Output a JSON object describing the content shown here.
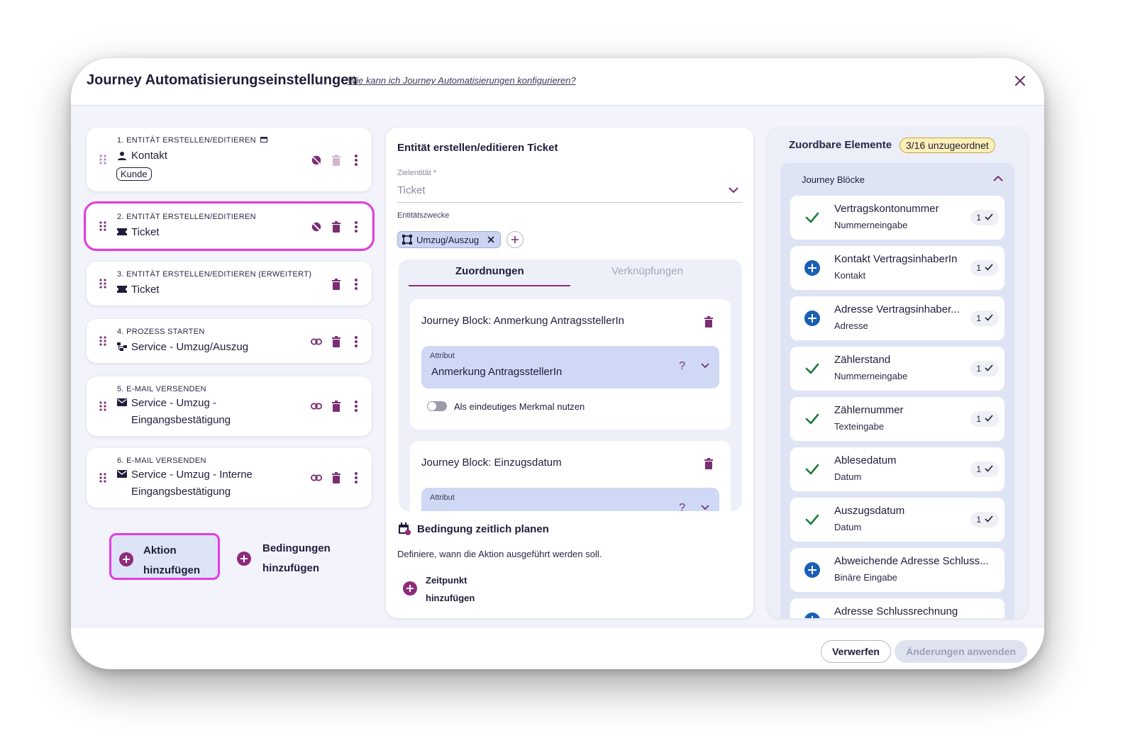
{
  "header": {
    "title": "Journey Automatisierungseinstellungen",
    "help_link": "Wie kann ich Journey Automatisierungen konfigurieren?"
  },
  "actions": [
    {
      "kicker": "1. ENTITÄT ERSTELLEN/EDITIEREN",
      "title": "Kontakt",
      "title_icon": "person-icon",
      "tag": "Kunde"
    },
    {
      "kicker": "2. ENTITÄT ERSTELLEN/EDITIEREN",
      "title": "Ticket",
      "title_icon": "ticket-icon"
    },
    {
      "kicker": "3. ENTITÄT ERSTELLEN/EDITIEREN (ERWEITERT)",
      "title": "Ticket",
      "title_icon": "ticket-icon"
    },
    {
      "kicker": "4. PROZESS STARTEN",
      "title": "Service - Umzug/Auszug",
      "title_icon": "workflow-icon"
    },
    {
      "kicker": "5. E-MAIL VERSENDEN",
      "title_line1": "Service - Umzug -",
      "title_line2": "Eingangsbestätigung",
      "title_icon": "mail-icon"
    },
    {
      "kicker": "6. E-MAIL VERSENDEN",
      "title_line1": "Service - Umzug - Interne",
      "title_line2": "Eingangsbestätigung",
      "title_icon": "mail-icon"
    }
  ],
  "left_buttons": {
    "add_action_line1": "Aktion",
    "add_action_line2": "hinzufügen",
    "add_condition_line1": "Bedingungen",
    "add_condition_line2": "hinzufügen"
  },
  "editor": {
    "title": "Entität erstellen/editieren Ticket",
    "target_label": "Zielentität *",
    "target_value": "Ticket",
    "purposes_label": "Entitätszwecke",
    "purpose_chip": "Umzug/Auszug",
    "tabs": [
      "Zuordnungen",
      "Verknüpfungen"
    ],
    "blocks": [
      {
        "title": "Journey Block: Anmerkung AntragsstellerIn",
        "attr_label": "Attribut",
        "attr_value": "Anmerkung AntragsstellerIn",
        "toggle_label": "Als eindeutiges Merkmal nutzen"
      },
      {
        "title": "Journey Block: Einzugsdatum",
        "attr_label": "Attribut",
        "attr_value": ""
      }
    ],
    "schedule_title": "Bedingung zeitlich planen",
    "schedule_desc": "Definiere, wann die Aktion ausgeführt werden soll.",
    "add_time_line1": "Zeitpunkt",
    "add_time_line2": "hinzufügen"
  },
  "right": {
    "title": "Zuordbare Elemente",
    "badge": "3/16 unzugeordnet",
    "section": "Journey Blöcke",
    "items": [
      {
        "name": "Vertragskontonummer",
        "type": "Nummerneingabe",
        "count": "1",
        "status": "check"
      },
      {
        "name": "Kontakt VertragsinhaberIn",
        "type": "Kontakt",
        "count": "1",
        "status": "add"
      },
      {
        "name": "Adresse Vertragsinhaber...",
        "type": "Adresse",
        "count": "1",
        "status": "add"
      },
      {
        "name": "Zählerstand",
        "type": "Nummerneingabe",
        "count": "1",
        "status": "check"
      },
      {
        "name": "Zählernummer",
        "type": "Texteingabe",
        "count": "1",
        "status": "check"
      },
      {
        "name": "Ablesedatum",
        "type": "Datum",
        "count": "1",
        "status": "check"
      },
      {
        "name": "Auszugsdatum",
        "type": "Datum",
        "count": "1",
        "status": "check"
      },
      {
        "name": "Abweichende Adresse Schluss...",
        "type": "Binäre Eingabe",
        "count": "",
        "status": "add"
      },
      {
        "name": "Adresse Schlussrechnung",
        "type": "",
        "count": "",
        "status": "add"
      }
    ]
  },
  "footer": {
    "discard": "Verwerfen",
    "apply": "Änderungen anwenden"
  },
  "colors": {
    "accent_magenta": "#e33ce0",
    "primary_purple": "#8e2c7b",
    "check_green": "#1f7a3a",
    "add_blue": "#1a5fb4",
    "badge_yellow": "#fcefb8"
  }
}
